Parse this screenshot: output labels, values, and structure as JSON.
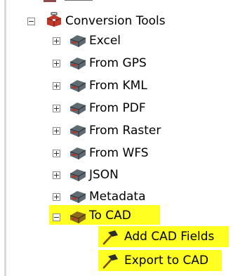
{
  "tree": {
    "root": {
      "label": "Conversion Tools",
      "expanded": true,
      "icon": "toolbox-icon"
    },
    "toolsets": [
      {
        "label": "Excel",
        "expanded": false,
        "icon": "toolbox-icon"
      },
      {
        "label": "From GPS",
        "expanded": false,
        "icon": "toolbox-icon"
      },
      {
        "label": "From KML",
        "expanded": false,
        "icon": "toolbox-icon"
      },
      {
        "label": "From PDF",
        "expanded": false,
        "icon": "toolbox-icon"
      },
      {
        "label": "From Raster",
        "expanded": false,
        "icon": "toolbox-icon"
      },
      {
        "label": "From WFS",
        "expanded": false,
        "icon": "toolbox-icon"
      },
      {
        "label": "JSON",
        "expanded": false,
        "icon": "toolbox-icon"
      },
      {
        "label": "Metadata",
        "expanded": false,
        "icon": "toolbox-icon"
      },
      {
        "label": "To CAD",
        "expanded": true,
        "highlighted": true,
        "icon": "toolbox-icon"
      }
    ],
    "tools": [
      {
        "label": "Add CAD Fields",
        "highlighted": true,
        "icon": "hammer-icon"
      },
      {
        "label": "Export to CAD",
        "highlighted": true,
        "icon": "hammer-icon"
      }
    ]
  },
  "colors": {
    "highlight": "#ffff22",
    "toolbox_red": "#c0392b",
    "toolset_gray": "#5f6b72"
  }
}
